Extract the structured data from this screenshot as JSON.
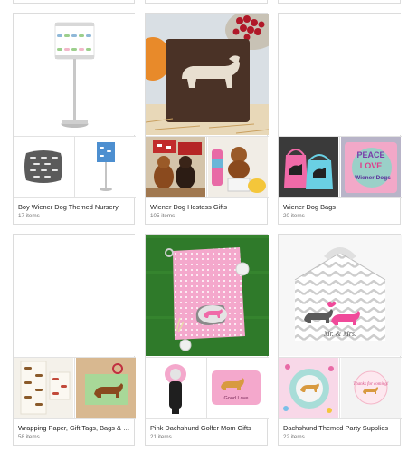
{
  "collections": [
    {
      "title": "Boy Wiener Dog Themed Nursery",
      "count": "17 items"
    },
    {
      "title": "Wiener Dog Hostess Gifts",
      "count": "105 items"
    },
    {
      "title": "Wiener Dog Bags",
      "count": "20 items"
    },
    {
      "title": "Wrapping Paper, Gift Tags, Bags & Box...",
      "count": "58 items"
    },
    {
      "title": "Pink Dachshund Golfer Mom Gifts",
      "count": "21 items"
    },
    {
      "title": "Dachshund Themed Party Supplies",
      "count": "22 items"
    }
  ],
  "tag_text": "Mr. & Mrs.",
  "sticker_text": "Thanks for coming!",
  "bag_text": "Peace Love Wiener Dogs",
  "peace_text": "PEACE",
  "love_text": "LOVE",
  "wiener_text": "Wiener Dogs",
  "mug_text": "Good Love",
  "colors": {
    "border": "#dcdcdc",
    "title": "#222222",
    "count": "#777777",
    "pink": "#f06aa8"
  }
}
